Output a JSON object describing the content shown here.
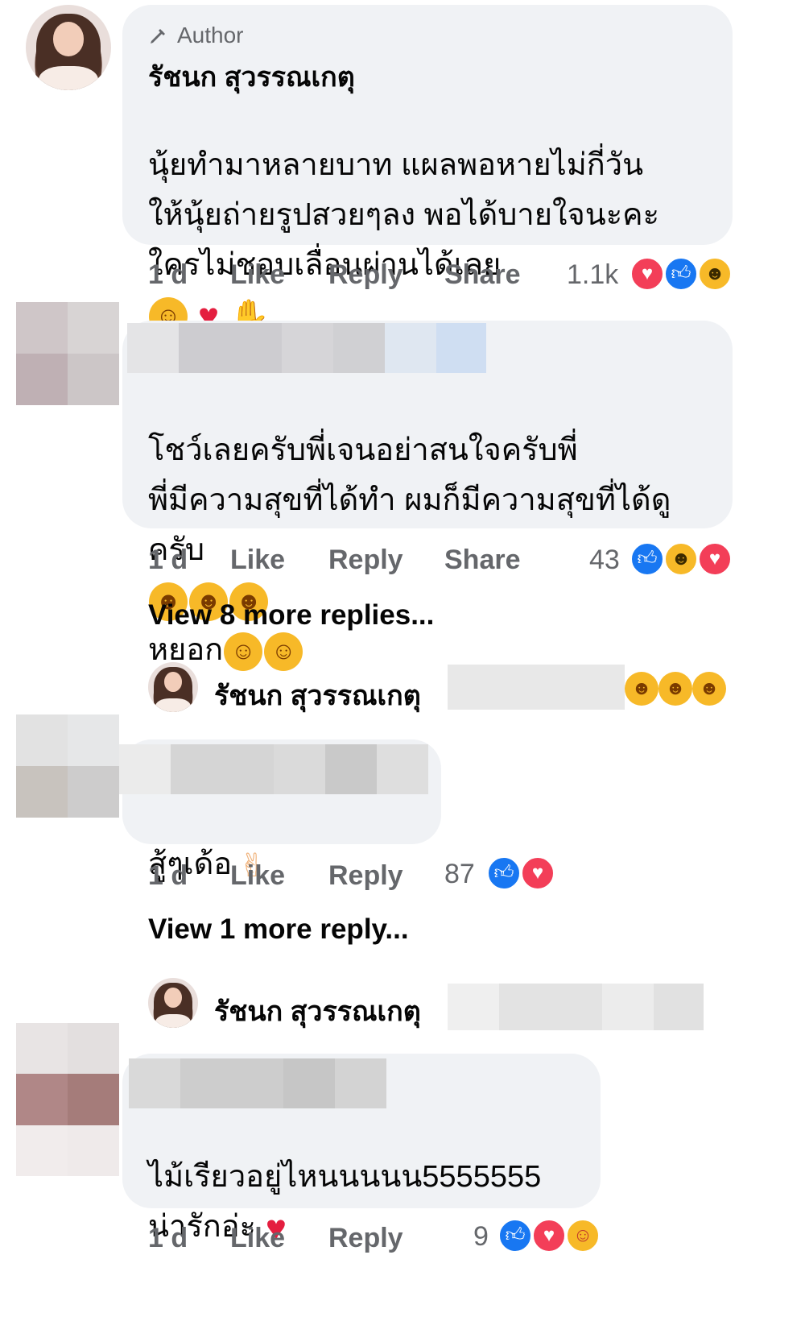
{
  "comments": [
    {
      "author_badge": "Author",
      "author_name": "รัชนก สุวรรณเกตุ",
      "text": "นุ้ยทำมาหลายบาท แผลพอหายไม่กี่วัน\nให้นุ้ยถ่ายรูปสวยๆลง พอได้บายใจนะคะ\nใครไม่ชอบเลื่อนผ่านได้เลย",
      "emojis": [
        "smiling-face-with-hearts",
        "red-heart",
        "folded-hands"
      ],
      "time": "1 d",
      "like": "Like",
      "reply": "Reply",
      "share": "Share",
      "reaction_count": "1.1k",
      "reactions": [
        "love",
        "like",
        "haha"
      ]
    },
    {
      "text": "โชว์เลยครับพี่เจนอย่าสนใจครับพี่\nพี่มีความสุขที่ได้ทำ ผมก็มีความสุขที่ได้ดู\nครับ",
      "text_tail": "หยอก",
      "time": "1 d",
      "like": "Like",
      "reply": "Reply",
      "share": "Share",
      "reaction_count": "43",
      "reactions": [
        "like",
        "haha",
        "love"
      ],
      "view_more": "View 8 more replies...",
      "reply_preview_name": "รัชนก สุวรรณเกตุ"
    },
    {
      "text": "สู้ๆเด้อ",
      "time": "1 d",
      "like": "Like",
      "reply": "Reply",
      "reaction_count": "87",
      "reactions": [
        "like",
        "love"
      ],
      "view_more": "View 1 more reply...",
      "reply_preview_name": "รัชนก สุวรรณเกตุ"
    },
    {
      "text": "ไม้เรียวอยู่ไหนนนนน5555555\nน่ารักอ่ะ",
      "time": "1 d",
      "like": "Like",
      "reply": "Reply",
      "reaction_count": "9",
      "reactions": [
        "like",
        "love",
        "care"
      ]
    }
  ],
  "icons": {
    "author_badge_icon": "pencil-icon",
    "like_reaction": "thumbs-up-icon",
    "love_reaction": "heart-icon",
    "haha_reaction": "laughing-face-icon",
    "care_reaction": "care-face-icon"
  },
  "colors": {
    "bubble": "#f0f2f5",
    "secondary_text": "#65676b",
    "like_blue": "#1877f2",
    "love_red": "#f33e58",
    "haha_yellow": "#f7b928"
  }
}
